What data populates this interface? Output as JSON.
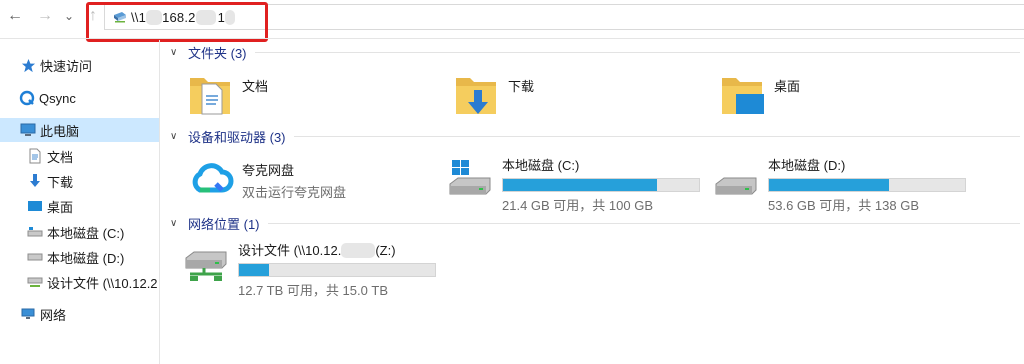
{
  "nav": {
    "back": "←",
    "forward": "→",
    "recent": "⌄",
    "up": "↑"
  },
  "address": {
    "part1": "\\\\1",
    "part2": "168.2",
    "part3": "1"
  },
  "sidebar": {
    "items": [
      {
        "label": "快速访问"
      },
      {
        "label": "Qsync"
      },
      {
        "label": "此电脑"
      },
      {
        "label": "文档"
      },
      {
        "label": "下载"
      },
      {
        "label": "桌面"
      },
      {
        "label": "本地磁盘 (C:)"
      },
      {
        "label": "本地磁盘 (D:)"
      },
      {
        "label": "设计文件 (\\\\10.12.2"
      },
      {
        "label": "网络"
      }
    ]
  },
  "groups": {
    "folders": {
      "title": "文件夹 (3)",
      "items": [
        {
          "name": "文档"
        },
        {
          "name": "下载"
        },
        {
          "name": "桌面"
        }
      ]
    },
    "devices": {
      "title": "设备和驱动器 (3)",
      "quark": {
        "name": "夸克网盘",
        "sub": "双击运行夸克网盘"
      },
      "drives": [
        {
          "name": "本地磁盘 (C:)",
          "usage": "21.4 GB 可用，共 100 GB",
          "used_fraction": 0.786
        },
        {
          "name": "本地磁盘 (D:)",
          "usage": "53.6 GB 可用，共 138 GB",
          "used_fraction": 0.612
        }
      ]
    },
    "network": {
      "title": "网络位置 (1)",
      "items": [
        {
          "name_start": "设计文件 (\\\\10.12.",
          "name_end": "(Z:)",
          "usage": "12.7 TB 可用，共 15.0 TB",
          "used_fraction": 0.153
        }
      ]
    }
  },
  "colors": {
    "accent": "#26a0da",
    "selected": "#cce8ff",
    "group_title": "#1e3287",
    "highlight_box": "#e02020"
  }
}
